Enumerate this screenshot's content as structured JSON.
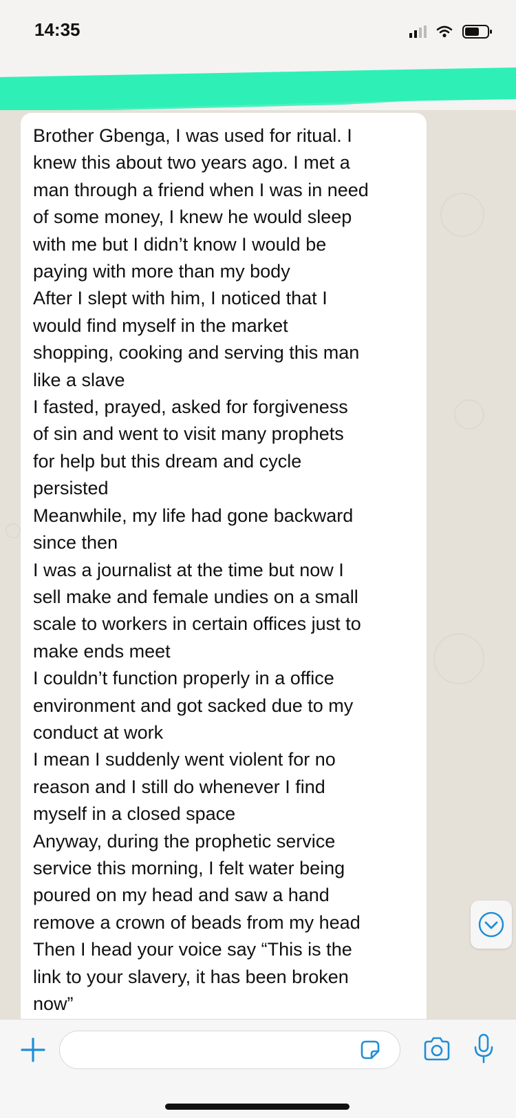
{
  "status_bar": {
    "time": "14:35",
    "icons": [
      "signal-icon",
      "wifi-icon",
      "battery-icon"
    ]
  },
  "colors": {
    "highlight": "#2ef0b6",
    "accent": "#1e8ed8",
    "bubble": "#ffffff",
    "chat_background": "#e6e1d8"
  },
  "message": {
    "lines": [
      "Brother Gbenga, I was used for ritual. I",
      "knew this about two years ago. I met a",
      "man through a friend when I was in need",
      "of some money, I knew he would sleep",
      "with me but I didn’t know I would be",
      "paying with more than my body",
      "After I slept with him, I noticed that I",
      "would find myself in the market",
      "shopping, cooking and serving this man",
      "like a slave",
      "I fasted, prayed, asked for forgiveness",
      "of sin and went to visit many prophets",
      "for help but this dream and cycle",
      "persisted",
      "Meanwhile, my life had gone backward",
      "since then",
      "I was a journalist at the time but now I",
      "sell make and female undies on a small",
      "scale to workers in certain offices just to",
      "make ends meet",
      "I couldn’t function properly in a office",
      "environment and got sacked due to my",
      "conduct at work",
      "I mean I suddenly went violent for no",
      "reason and I still do whenever I find",
      "myself in a closed space",
      "Anyway, during the prophetic service",
      "service this morning, I felt water being",
      "poured on my head and saw a hand",
      "remove a crown of beads from my head",
      "Then I head your voice say “This is the",
      "link to your slavery, it has been broken",
      "now”"
    ]
  },
  "input_bar": {
    "plus_icon": "plus-icon",
    "sticker_icon": "sticker-icon",
    "camera_icon": "camera-icon",
    "mic_icon": "microphone-icon"
  },
  "scroll_button_icon": "chevron-down-icon"
}
